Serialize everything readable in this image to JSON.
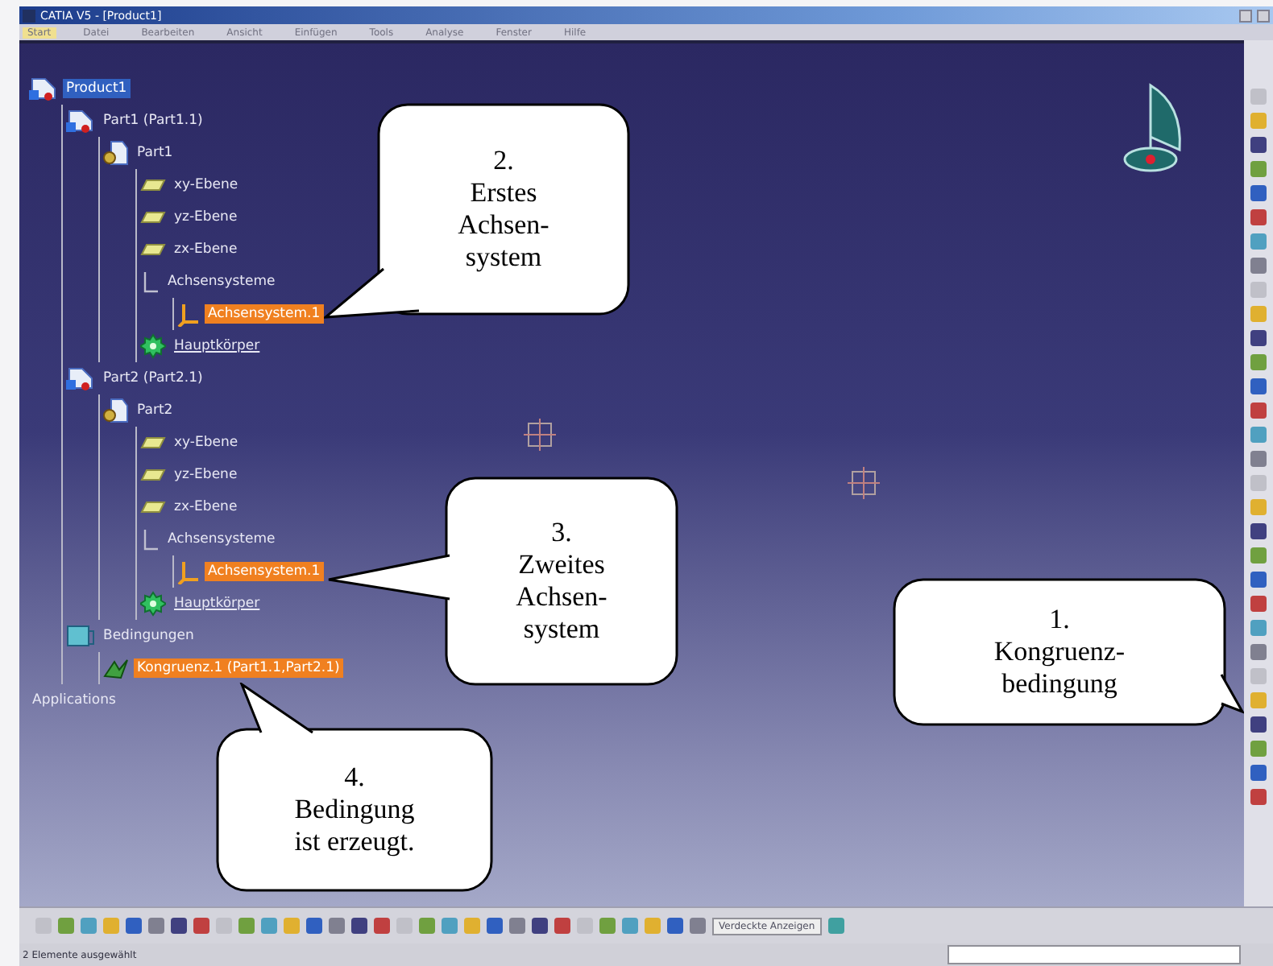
{
  "window": {
    "title": "CATIA V5 - [Product1]"
  },
  "menu": [
    {
      "label": "Start",
      "selected": true
    },
    {
      "label": "Datei",
      "selected": false
    },
    {
      "label": "Bearbeiten",
      "selected": false
    },
    {
      "label": "Ansicht",
      "selected": false
    },
    {
      "label": "Einfügen",
      "selected": false
    },
    {
      "label": "Tools",
      "selected": false
    },
    {
      "label": "Analyse",
      "selected": false
    },
    {
      "label": "Fenster",
      "selected": false
    },
    {
      "label": "Hilfe",
      "selected": false
    }
  ],
  "tree": [
    {
      "label": "Product1",
      "kind": "product",
      "selected": false,
      "children": [
        {
          "label": "Part1 (Part1.1)",
          "kind": "part",
          "selected": false,
          "children": [
            {
              "label": "Part1",
              "kind": "body",
              "selected": false,
              "children": [
                {
                  "label": "xy-Ebene",
                  "kind": "plane",
                  "selected": false
                },
                {
                  "label": "yz-Ebene",
                  "kind": "plane",
                  "selected": false
                },
                {
                  "label": "zx-Ebene",
                  "kind": "plane",
                  "selected": false
                },
                {
                  "label": "Achsensysteme",
                  "kind": "axes",
                  "selected": false,
                  "children": [
                    {
                      "label": "Achsensystem.1",
                      "kind": "axis",
                      "selected": true
                    }
                  ]
                },
                {
                  "label": "Hauptkörper",
                  "kind": "mainbody",
                  "selected": false
                }
              ]
            }
          ]
        },
        {
          "label": "Part2 (Part2.1)",
          "kind": "part",
          "selected": false,
          "children": [
            {
              "label": "Part2",
              "kind": "body",
              "selected": false,
              "children": [
                {
                  "label": "xy-Ebene",
                  "kind": "plane",
                  "selected": false
                },
                {
                  "label": "yz-Ebene",
                  "kind": "plane",
                  "selected": false
                },
                {
                  "label": "zx-Ebene",
                  "kind": "plane",
                  "selected": false
                },
                {
                  "label": "Achsensysteme",
                  "kind": "axes",
                  "selected": false,
                  "children": [
                    {
                      "label": "Achsensystem.1",
                      "kind": "axis",
                      "selected": true
                    }
                  ]
                },
                {
                  "label": "Hauptkörper",
                  "kind": "mainbody",
                  "selected": false
                }
              ]
            }
          ]
        },
        {
          "label": "Bedingungen",
          "kind": "constraints",
          "selected": false,
          "children": [
            {
              "label": "Kongruenz.1 (Part1.1,Part2.1)",
              "kind": "constraint",
              "selected": true
            }
          ]
        }
      ]
    },
    {
      "label": "Applications",
      "kind": "applications",
      "selected": false
    }
  ],
  "callouts": [
    {
      "text": "2.\nErstes\nAchsen-\nsystem"
    },
    {
      "text": "3.\nZweites\nAchsen-\nsystem"
    },
    {
      "text": "1.\nKongruenz-\nbedingung"
    },
    {
      "text": "4.\nBedingung\nist erzeugt."
    }
  ],
  "toolbar": {
    "combo": "Verdeckte Anzeigen"
  },
  "status_bar": {
    "text": "2 Elemente ausgewählt"
  }
}
